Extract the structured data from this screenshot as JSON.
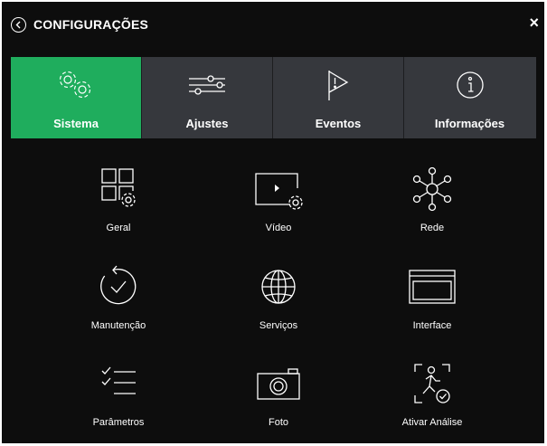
{
  "window": {
    "title": "CONFIGURAÇÕES",
    "close_glyph": "×"
  },
  "tabs": [
    {
      "label": "Sistema",
      "icon": "gears-icon",
      "active": true
    },
    {
      "label": "Ajustes",
      "icon": "sliders-icon",
      "active": false
    },
    {
      "label": "Eventos",
      "icon": "flag-alert-icon",
      "active": false
    },
    {
      "label": "Informações",
      "icon": "info-icon",
      "active": false
    }
  ],
  "items": [
    {
      "label": "Geral",
      "icon": "general-settings-icon"
    },
    {
      "label": "Vídeo",
      "icon": "video-settings-icon"
    },
    {
      "label": "Rede",
      "icon": "network-icon"
    },
    {
      "label": "Manutenção",
      "icon": "maintenance-icon"
    },
    {
      "label": "Serviços",
      "icon": "globe-icon"
    },
    {
      "label": "Interface",
      "icon": "interface-window-icon"
    },
    {
      "label": "Parâmetros",
      "icon": "checklist-icon"
    },
    {
      "label": "Foto",
      "icon": "camera-icon"
    },
    {
      "label": "Ativar Análise",
      "icon": "person-analysis-icon"
    }
  ],
  "colors": {
    "active_tab": "#1fad5d",
    "tab_bar": "#36383d",
    "background": "#0d0d0d",
    "foreground": "#ffffff"
  }
}
